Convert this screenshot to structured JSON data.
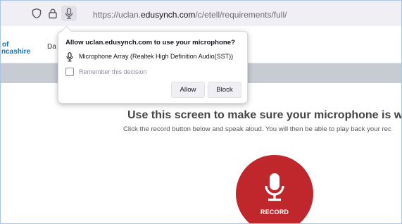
{
  "browser": {
    "url_prefix": "https://uclan.",
    "url_host": "edusynch.com",
    "url_path": "/c/etell/requirements/full/"
  },
  "site": {
    "logo_line1": "of",
    "logo_line2": "ncashire",
    "nav_partial": "Da"
  },
  "permission_popup": {
    "title": "Allow uclan.edusynch.com to use your microphone?",
    "device": "Microphone Array (Realtek High Definition Audio(SST))",
    "remember_label": "Remember this decision",
    "remember_checked": false,
    "allow_label": "Allow",
    "block_label": "Block"
  },
  "main": {
    "heading": "Use this screen to make sure your microphone is workin",
    "subtext": "Click the record button below and speak aloud. You will then be able to play back your rec",
    "record_label": "RECORD"
  },
  "colors": {
    "record_button": "#c0272d",
    "logo_blue": "#0a74b8",
    "grey_band": "#c7cbd2",
    "window_border": "#a9c4e4"
  },
  "icons": [
    "shield-icon",
    "lock-icon",
    "microphone-icon"
  ]
}
